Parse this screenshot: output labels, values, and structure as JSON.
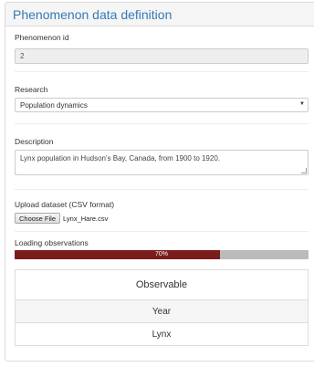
{
  "panel": {
    "title": "Phenomenon data definition"
  },
  "phenomenon_id": {
    "label": "Phenomenon id",
    "value": "2"
  },
  "research": {
    "label": "Research",
    "selected": "Population dynamics"
  },
  "description": {
    "label": "Description",
    "value": "Lynx population in Hudson's Bay, Canada, from 1900 to 1920."
  },
  "upload": {
    "label": "Upload dataset (CSV format)",
    "button_label": "Choose File",
    "file_name": "Lynx_Hare.csv"
  },
  "loading": {
    "label": "Loading observations",
    "progress_percent": 70,
    "progress_text": "70%"
  },
  "observables_table": {
    "header": "Observable",
    "rows": [
      "Year",
      "Lynx"
    ]
  },
  "icons": {
    "select_caret": "caret-down-icon"
  }
}
